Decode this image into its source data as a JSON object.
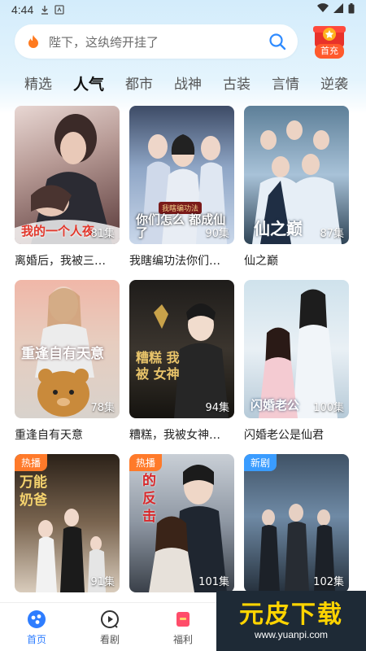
{
  "status": {
    "time": "4:44"
  },
  "search": {
    "placeholder": "陛下，这纨绔开挂了"
  },
  "recharge": {
    "label": "首充"
  },
  "tabs": [
    "精选",
    "人气",
    "都市",
    "战神",
    "古装",
    "言情",
    "逆袭"
  ],
  "active_tab": "人气",
  "cards": [
    {
      "title": "离婚后，我被三…",
      "episodes": "81集",
      "poster_text": "我的一个人夜",
      "tag": ""
    },
    {
      "title": "我瞎编功法你们…",
      "episodes": "90集",
      "poster_text": "你们怎么 都成仙了",
      "poster_sub": "我瞎编功法",
      "tag": ""
    },
    {
      "title": "仙之巅",
      "episodes": "87集",
      "poster_text": "仙之巅",
      "tag": ""
    },
    {
      "title": "重逢自有天意",
      "episodes": "78集",
      "poster_text": "重逢自有天意",
      "tag": ""
    },
    {
      "title": "糟糕，我被女神…",
      "episodes": "94集",
      "poster_text": "糟糕 我被 女神",
      "tag": ""
    },
    {
      "title": "闪婚老公是仙君",
      "episodes": "100集",
      "poster_text": "闪婚老公",
      "tag": ""
    },
    {
      "title": "",
      "episodes": "91集",
      "poster_text": "万能奶爸",
      "tag": "热播"
    },
    {
      "title": "",
      "episodes": "101集",
      "poster_text": "的反击",
      "tag": "热播"
    },
    {
      "title": "",
      "episodes": "102集",
      "poster_text": "",
      "tag": "新剧"
    }
  ],
  "nav": [
    {
      "label": "首页",
      "icon": "home-icon"
    },
    {
      "label": "看剧",
      "icon": "play-icon"
    },
    {
      "label": "福利",
      "icon": "gift-icon"
    }
  ],
  "watermark": {
    "text": "元皮下载",
    "url": "www.yuanpi.com"
  },
  "colors": {
    "accent": "#2e7dff",
    "hot_tag": "#ff7a2a",
    "new_tag": "#3a9cff"
  }
}
